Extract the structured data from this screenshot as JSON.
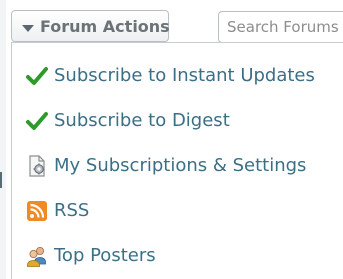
{
  "toolbar": {
    "actions_label": "Forum Actions",
    "search_placeholder": "Search Forums"
  },
  "menu": {
    "items": [
      {
        "label": "Subscribe to Instant Updates",
        "icon": "check-icon"
      },
      {
        "label": "Subscribe to Digest",
        "icon": "check-icon"
      },
      {
        "label": "My Subscriptions & Settings",
        "icon": "document-gear-icon"
      },
      {
        "label": "RSS",
        "icon": "rss-icon"
      },
      {
        "label": "Top Posters",
        "icon": "users-icon"
      }
    ]
  },
  "colors": {
    "link": "#3b6f86",
    "check": "#2e9a2b",
    "rss": "#f08a24"
  }
}
